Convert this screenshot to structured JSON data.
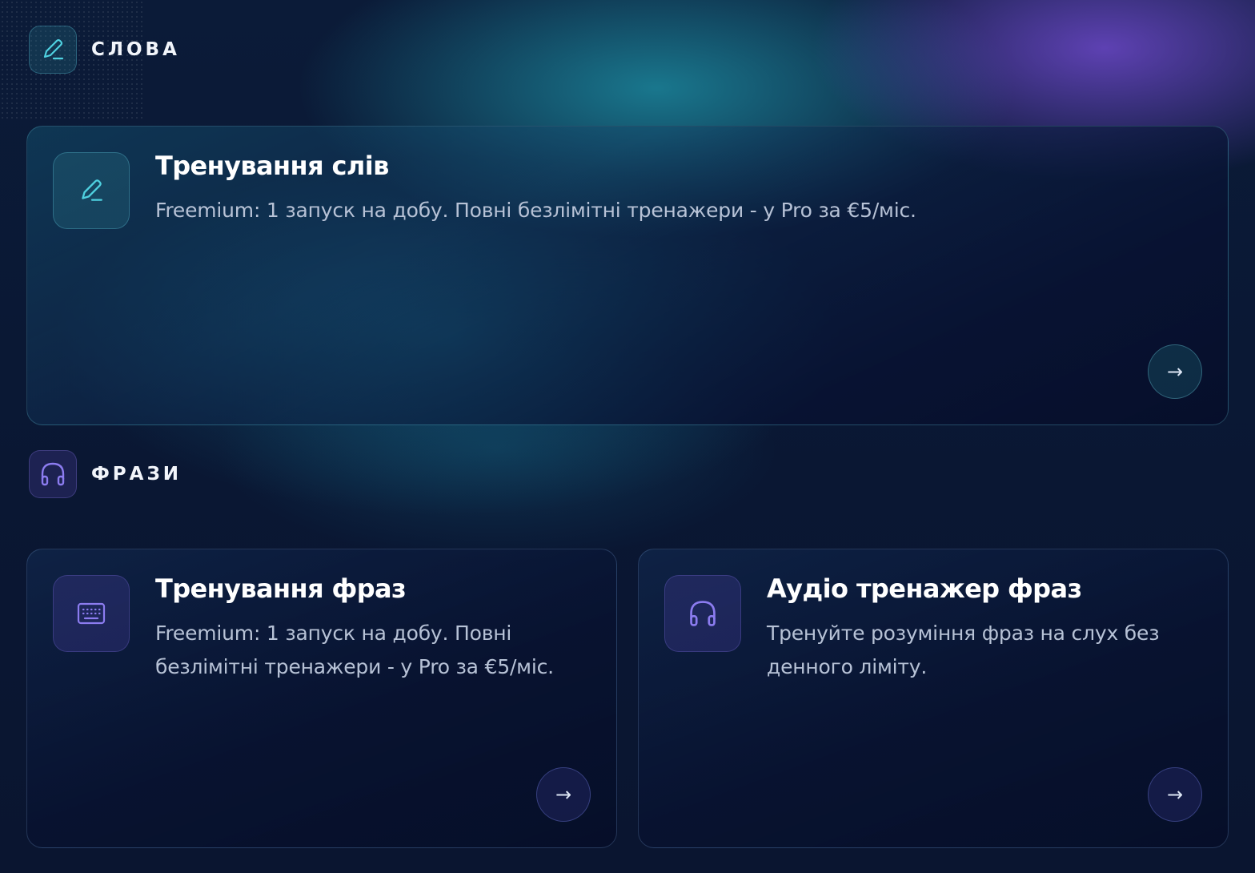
{
  "sections": {
    "words": {
      "title": "СЛОВА",
      "icon": "pencil-icon",
      "cards": [
        {
          "title": "Тренування слів",
          "description": "Freemium: 1 запуск на добу. Повні безлімітні тренажери - у Pro за €5/міс.",
          "icon": "pencil-icon",
          "action": "→"
        }
      ]
    },
    "phrases": {
      "title": "ФРАЗИ",
      "icon": "headphones-icon",
      "cards": [
        {
          "title": "Тренування фраз",
          "description": "Freemium: 1 запуск на добу. Повні безлімітні тренажери - у Pro за €5/міс.",
          "icon": "keyboard-icon",
          "action": "→"
        },
        {
          "title": "Аудіо тренажер фраз",
          "description": "Тренуйте розуміння фраз на слух без денного ліміту.",
          "icon": "headphones-icon",
          "action": "→"
        }
      ]
    }
  },
  "colors": {
    "teal_accent": "#4fd1e0",
    "violet_accent": "#8c7cf0",
    "background": "#0a1733"
  }
}
